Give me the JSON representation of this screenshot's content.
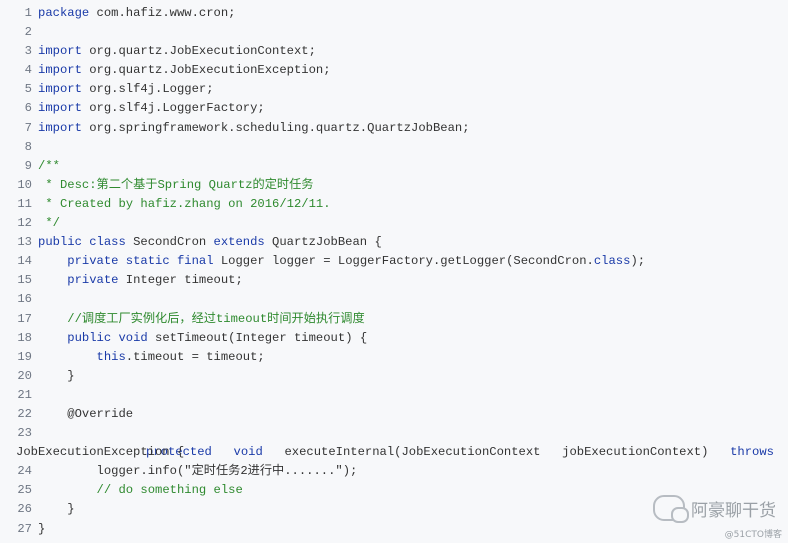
{
  "lines": [
    {
      "n": "1",
      "tokens": [
        {
          "t": "package",
          "c": "kw"
        },
        {
          "t": " com.hafiz.www.cron;",
          "c": "st"
        }
      ]
    },
    {
      "n": "2",
      "tokens": []
    },
    {
      "n": "3",
      "tokens": [
        {
          "t": "import",
          "c": "kw"
        },
        {
          "t": " org.quartz.JobExecutionContext;",
          "c": "st"
        }
      ]
    },
    {
      "n": "4",
      "tokens": [
        {
          "t": "import",
          "c": "kw"
        },
        {
          "t": " org.quartz.JobExecutionException;",
          "c": "st"
        }
      ]
    },
    {
      "n": "5",
      "tokens": [
        {
          "t": "import",
          "c": "kw"
        },
        {
          "t": " org.slf4j.Logger;",
          "c": "st"
        }
      ]
    },
    {
      "n": "6",
      "tokens": [
        {
          "t": "import",
          "c": "kw"
        },
        {
          "t": " org.slf4j.LoggerFactory;",
          "c": "st"
        }
      ]
    },
    {
      "n": "7",
      "tokens": [
        {
          "t": "import",
          "c": "kw"
        },
        {
          "t": " org.springframework.scheduling.quartz.QuartzJobBean;",
          "c": "st"
        }
      ]
    },
    {
      "n": "8",
      "tokens": []
    },
    {
      "n": "9",
      "tokens": [
        {
          "t": "/**",
          "c": "cm"
        }
      ]
    },
    {
      "n": "10",
      "tokens": [
        {
          "t": " * Desc:第二个基于Spring Quartz的定时任务",
          "c": "cm"
        }
      ]
    },
    {
      "n": "11",
      "tokens": [
        {
          "t": " * Created by hafiz.zhang on 2016/12/11.",
          "c": "cm"
        }
      ]
    },
    {
      "n": "12",
      "tokens": [
        {
          "t": " */",
          "c": "cm"
        }
      ]
    },
    {
      "n": "13",
      "tokens": [
        {
          "t": "public class",
          "c": "kw"
        },
        {
          "t": " SecondCron ",
          "c": "st"
        },
        {
          "t": "extends",
          "c": "kw"
        },
        {
          "t": " QuartzJobBean {",
          "c": "st"
        }
      ]
    },
    {
      "n": "14",
      "tokens": [
        {
          "t": "    ",
          "c": "st"
        },
        {
          "t": "private static final",
          "c": "kw"
        },
        {
          "t": " Logger logger = LoggerFactory.getLogger(SecondCron.",
          "c": "st"
        },
        {
          "t": "class",
          "c": "kw"
        },
        {
          "t": ");",
          "c": "st"
        }
      ]
    },
    {
      "n": "15",
      "tokens": [
        {
          "t": "    ",
          "c": "st"
        },
        {
          "t": "private",
          "c": "kw"
        },
        {
          "t": " Integer timeout;",
          "c": "st"
        }
      ]
    },
    {
      "n": "16",
      "tokens": []
    },
    {
      "n": "17",
      "tokens": [
        {
          "t": "    //调度工厂实例化后，经过timeout时间开始执行调度",
          "c": "cm"
        }
      ]
    },
    {
      "n": "18",
      "tokens": [
        {
          "t": "    ",
          "c": "st"
        },
        {
          "t": "public void",
          "c": "kw"
        },
        {
          "t": " setTimeout(Integer timeout) {",
          "c": "st"
        }
      ]
    },
    {
      "n": "19",
      "tokens": [
        {
          "t": "        ",
          "c": "st"
        },
        {
          "t": "this",
          "c": "kw"
        },
        {
          "t": ".timeout = timeout;",
          "c": "st"
        }
      ]
    },
    {
      "n": "20",
      "tokens": [
        {
          "t": "    }",
          "c": "st"
        }
      ]
    },
    {
      "n": "21",
      "tokens": []
    },
    {
      "n": "22",
      "tokens": [
        {
          "t": "    @Override",
          "c": "st"
        }
      ]
    }
  ],
  "line23": {
    "n": "23",
    "parts": [
      {
        "t": "protected",
        "c": "kw"
      },
      {
        "t": "void",
        "c": "kw"
      },
      {
        "t": "executeInternal(JobExecutionContext",
        "c": "st"
      },
      {
        "t": "jobExecutionContext)",
        "c": "st"
      },
      {
        "t": "throws",
        "c": "kw"
      }
    ],
    "continuation": "JobExecutionException {"
  },
  "lines2": [
    {
      "n": "24",
      "tokens": [
        {
          "t": "        logger.info(\"定时任务2进行中.......\");",
          "c": "st"
        }
      ]
    },
    {
      "n": "25",
      "tokens": [
        {
          "t": "        // do something else",
          "c": "cm"
        }
      ]
    },
    {
      "n": "26",
      "tokens": [
        {
          "t": "    }",
          "c": "st"
        }
      ]
    },
    {
      "n": "27",
      "tokens": [
        {
          "t": "}",
          "c": "st"
        }
      ]
    }
  ],
  "watermark": {
    "text": "阿豪聊干货",
    "icon": "wechat-icon"
  },
  "credit": "@51CTO博客"
}
